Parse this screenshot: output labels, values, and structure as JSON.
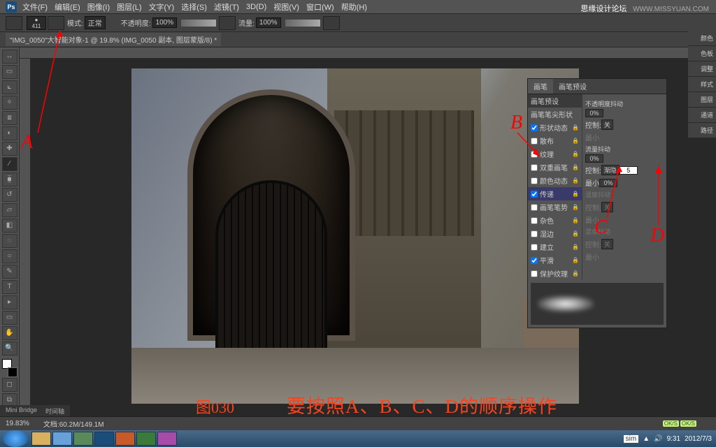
{
  "watermark": {
    "site": "思缘设计论坛",
    "url": "WWW.MISSYUAN.COM"
  },
  "menubar": [
    "文件(F)",
    "编辑(E)",
    "图像(I)",
    "图层(L)",
    "文字(Y)",
    "选择(S)",
    "滤镜(T)",
    "3D(D)",
    "视图(V)",
    "窗口(W)",
    "帮助(H)"
  ],
  "ps_icon": "Ps",
  "optbar": {
    "brush_size": "411",
    "mode_label": "模式:",
    "mode_value": "正常",
    "opacity_label": "不透明度:",
    "opacity_value": "100%",
    "flow_label": "流量:",
    "flow_value": "100%"
  },
  "tabbar": {
    "doc": "\"IMG_0050\"大智能对象-1 @ 19.8% (IMG_0050 副本, 图层蒙版/8) *"
  },
  "right_groups": [
    "颜色",
    "色板",
    "调整",
    "样式",
    "图层",
    "通道",
    "路径"
  ],
  "brush_panel": {
    "tabs": [
      "画笔",
      "画笔预设"
    ],
    "active_tab": 0,
    "left_header": "画笔预设",
    "items": [
      {
        "label": "画笔笔尖形状",
        "check": null
      },
      {
        "label": "形状动态",
        "check": true,
        "lock": true
      },
      {
        "label": "散布",
        "check": false,
        "lock": true
      },
      {
        "label": "纹理",
        "check": false,
        "lock": true
      },
      {
        "label": "双重画笔",
        "check": false,
        "lock": true
      },
      {
        "label": "颜色动态",
        "check": false,
        "lock": true
      },
      {
        "label": "传递",
        "check": true,
        "lock": true
      },
      {
        "label": "画笔笔势",
        "check": false,
        "lock": true
      },
      {
        "label": "杂色",
        "check": false,
        "lock": true
      },
      {
        "label": "湿边",
        "check": false,
        "lock": true
      },
      {
        "label": "建立",
        "check": false,
        "lock": true
      },
      {
        "label": "平滑",
        "check": true,
        "lock": true
      },
      {
        "label": "保护纹理",
        "check": false,
        "lock": true
      }
    ],
    "controls": {
      "opacity_jitter_label": "不透明度抖动",
      "opacity_jitter_val": "0%",
      "control1_label": "控制:",
      "control1_val": "关",
      "min1_label": "最小",
      "flow_jitter_label": "流量抖动",
      "flow_jitter_val": "0%",
      "control2_label": "控制:",
      "control2_val": "渐隐",
      "control2_num": "5",
      "min2_label": "最小",
      "min2_val": "0%",
      "wet_jitter_label": "湿度抖动",
      "control3_label": "控制:",
      "control3_val": "关",
      "min3_label": "最小",
      "mix_jitter_label": "混合抖动",
      "control4_label": "控制:",
      "control4_val": "关",
      "min4_label": "最小"
    }
  },
  "annotations": {
    "A": "A",
    "B": "B",
    "C": "C",
    "D": "D",
    "fig": "图030",
    "instruction": "要按照A、B、C、D的顺序操作"
  },
  "statusbar": {
    "zoom": "19.83%",
    "size": "文档:60.2M/149.1M",
    "mini": "Mini Bridge",
    "timeline": "时间轴"
  },
  "ok_pill": "OK/S",
  "taskbar": {
    "time": "9:31",
    "date": "2012/7/3",
    "ime": "sim"
  }
}
